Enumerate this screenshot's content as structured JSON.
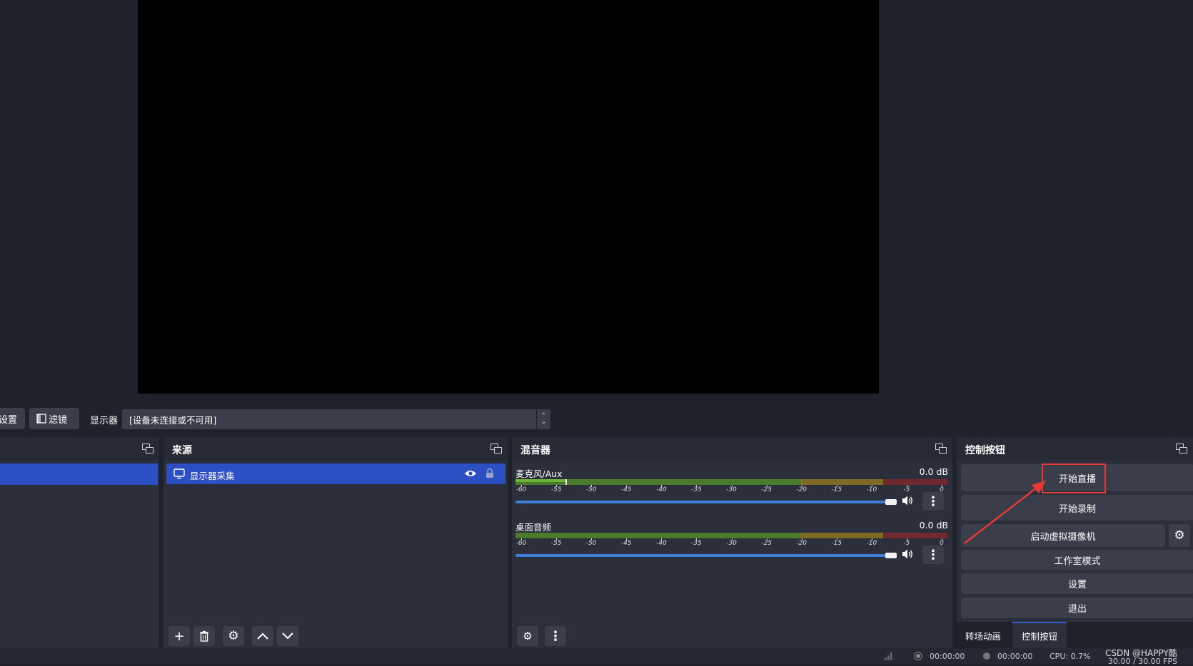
{
  "toolbar": {
    "properties_label": "设置",
    "filters_label": "滤镜",
    "display_label": "显示器",
    "display_value": "[设备未连接或不可用]"
  },
  "sources": {
    "title": "来源",
    "items": [
      {
        "label": "显示器采集",
        "visible_icon": "eye-icon",
        "lock_icon": "lock-icon"
      }
    ]
  },
  "mixer": {
    "title": "混音器",
    "channels": [
      {
        "name": "麦克风/Aux",
        "db": "0.0 dB",
        "level": 0.12
      },
      {
        "name": "桌面音频",
        "db": "0.0 dB",
        "level": 0.0
      }
    ],
    "scale_ticks": [
      "-60",
      "-55",
      "-50",
      "-45",
      "-40",
      "-35",
      "-30",
      "-25",
      "-20",
      "-15",
      "-10",
      "-5",
      "0"
    ]
  },
  "controls": {
    "title": "控制按钮",
    "start_stream": "开始直播",
    "start_record": "开始录制",
    "virtual_cam": "启动虚拟摄像机",
    "studio_mode": "工作室模式",
    "settings": "设置",
    "exit": "退出",
    "tabs": [
      {
        "label": "转场动画"
      },
      {
        "label": "控制按钮"
      }
    ]
  },
  "status": {
    "stream_time": "00:00:00",
    "record_time": "00:00:00",
    "cpu": "CPU: 0.7%",
    "fps": "30.00 / 30.00 FPS"
  },
  "watermark": "CSDN @HAPPY酷",
  "colors": {
    "selected": "#2c4fc4",
    "highlight_box": "#e53935",
    "meter_green": "#6bb53a",
    "meter_yellow": "#c8a22a",
    "meter_red": "#b03838",
    "volume_blue": "#3d7fd6"
  }
}
